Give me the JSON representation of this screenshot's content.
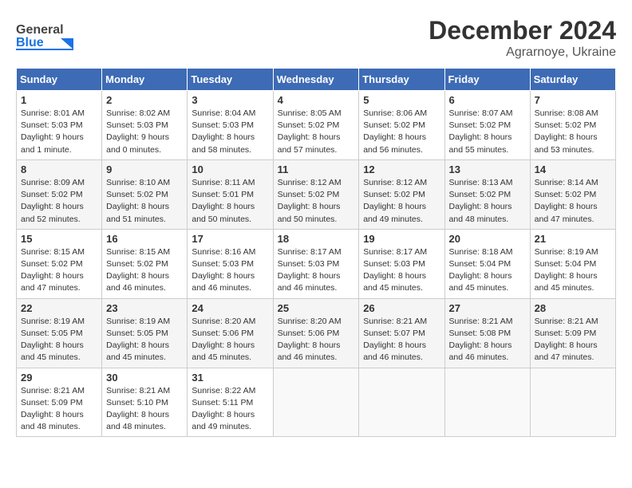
{
  "header": {
    "logo": {
      "text_general": "General",
      "text_blue": "Blue"
    },
    "title": "December 2024",
    "location": "Agrarnoye, Ukraine"
  },
  "calendar": {
    "days_of_week": [
      "Sunday",
      "Monday",
      "Tuesday",
      "Wednesday",
      "Thursday",
      "Friday",
      "Saturday"
    ],
    "weeks": [
      [
        {
          "day": 1,
          "sunrise": "8:01 AM",
          "sunset": "5:03 PM",
          "daylight": "9 hours and 1 minute."
        },
        {
          "day": 2,
          "sunrise": "8:02 AM",
          "sunset": "5:03 PM",
          "daylight": "9 hours and 0 minutes."
        },
        {
          "day": 3,
          "sunrise": "8:04 AM",
          "sunset": "5:03 PM",
          "daylight": "8 hours and 58 minutes."
        },
        {
          "day": 4,
          "sunrise": "8:05 AM",
          "sunset": "5:02 PM",
          "daylight": "8 hours and 57 minutes."
        },
        {
          "day": 5,
          "sunrise": "8:06 AM",
          "sunset": "5:02 PM",
          "daylight": "8 hours and 56 minutes."
        },
        {
          "day": 6,
          "sunrise": "8:07 AM",
          "sunset": "5:02 PM",
          "daylight": "8 hours and 55 minutes."
        },
        {
          "day": 7,
          "sunrise": "8:08 AM",
          "sunset": "5:02 PM",
          "daylight": "8 hours and 53 minutes."
        }
      ],
      [
        {
          "day": 8,
          "sunrise": "8:09 AM",
          "sunset": "5:02 PM",
          "daylight": "8 hours and 52 minutes."
        },
        {
          "day": 9,
          "sunrise": "8:10 AM",
          "sunset": "5:02 PM",
          "daylight": "8 hours and 51 minutes."
        },
        {
          "day": 10,
          "sunrise": "8:11 AM",
          "sunset": "5:01 PM",
          "daylight": "8 hours and 50 minutes."
        },
        {
          "day": 11,
          "sunrise": "8:12 AM",
          "sunset": "5:02 PM",
          "daylight": "8 hours and 50 minutes."
        },
        {
          "day": 12,
          "sunrise": "8:12 AM",
          "sunset": "5:02 PM",
          "daylight": "8 hours and 49 minutes."
        },
        {
          "day": 13,
          "sunrise": "8:13 AM",
          "sunset": "5:02 PM",
          "daylight": "8 hours and 48 minutes."
        },
        {
          "day": 14,
          "sunrise": "8:14 AM",
          "sunset": "5:02 PM",
          "daylight": "8 hours and 47 minutes."
        }
      ],
      [
        {
          "day": 15,
          "sunrise": "8:15 AM",
          "sunset": "5:02 PM",
          "daylight": "8 hours and 47 minutes."
        },
        {
          "day": 16,
          "sunrise": "8:15 AM",
          "sunset": "5:02 PM",
          "daylight": "8 hours and 46 minutes."
        },
        {
          "day": 17,
          "sunrise": "8:16 AM",
          "sunset": "5:03 PM",
          "daylight": "8 hours and 46 minutes."
        },
        {
          "day": 18,
          "sunrise": "8:17 AM",
          "sunset": "5:03 PM",
          "daylight": "8 hours and 46 minutes."
        },
        {
          "day": 19,
          "sunrise": "8:17 AM",
          "sunset": "5:03 PM",
          "daylight": "8 hours and 45 minutes."
        },
        {
          "day": 20,
          "sunrise": "8:18 AM",
          "sunset": "5:04 PM",
          "daylight": "8 hours and 45 minutes."
        },
        {
          "day": 21,
          "sunrise": "8:19 AM",
          "sunset": "5:04 PM",
          "daylight": "8 hours and 45 minutes."
        }
      ],
      [
        {
          "day": 22,
          "sunrise": "8:19 AM",
          "sunset": "5:05 PM",
          "daylight": "8 hours and 45 minutes."
        },
        {
          "day": 23,
          "sunrise": "8:19 AM",
          "sunset": "5:05 PM",
          "daylight": "8 hours and 45 minutes."
        },
        {
          "day": 24,
          "sunrise": "8:20 AM",
          "sunset": "5:06 PM",
          "daylight": "8 hours and 45 minutes."
        },
        {
          "day": 25,
          "sunrise": "8:20 AM",
          "sunset": "5:06 PM",
          "daylight": "8 hours and 46 minutes."
        },
        {
          "day": 26,
          "sunrise": "8:21 AM",
          "sunset": "5:07 PM",
          "daylight": "8 hours and 46 minutes."
        },
        {
          "day": 27,
          "sunrise": "8:21 AM",
          "sunset": "5:08 PM",
          "daylight": "8 hours and 46 minutes."
        },
        {
          "day": 28,
          "sunrise": "8:21 AM",
          "sunset": "5:09 PM",
          "daylight": "8 hours and 47 minutes."
        }
      ],
      [
        {
          "day": 29,
          "sunrise": "8:21 AM",
          "sunset": "5:09 PM",
          "daylight": "8 hours and 48 minutes."
        },
        {
          "day": 30,
          "sunrise": "8:21 AM",
          "sunset": "5:10 PM",
          "daylight": "8 hours and 48 minutes."
        },
        {
          "day": 31,
          "sunrise": "8:22 AM",
          "sunset": "5:11 PM",
          "daylight": "8 hours and 49 minutes."
        },
        null,
        null,
        null,
        null
      ]
    ]
  }
}
